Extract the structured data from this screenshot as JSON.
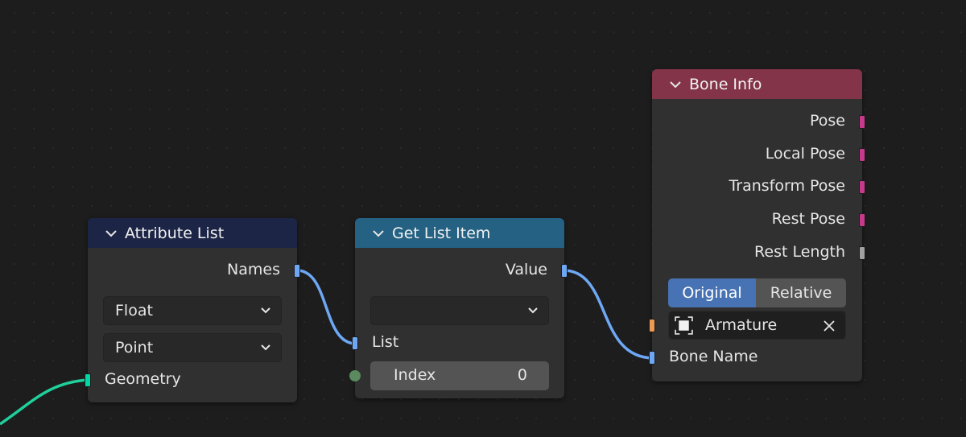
{
  "nodes": {
    "attribute_list": {
      "title": "Attribute List",
      "header_color": "#1d2547",
      "outputs": {
        "names": "Names"
      },
      "data_type": "Float",
      "domain": "Point",
      "inputs": {
        "geometry": "Geometry"
      }
    },
    "get_list_item": {
      "title": "Get List Item",
      "header_color": "#246182",
      "outputs": {
        "value": "Value"
      },
      "type_select": "",
      "inputs": {
        "list": "List",
        "index_label": "Index",
        "index_value": "0"
      }
    },
    "bone_info": {
      "title": "Bone Info",
      "header_color": "#843449",
      "outputs": [
        "Pose",
        "Local Pose",
        "Transform Pose",
        "Rest Pose",
        "Rest Length"
      ],
      "mode_options": [
        "Original",
        "Relative"
      ],
      "mode_selected": "Original",
      "armature": "Armature",
      "inputs": {
        "bone_name": "Bone Name"
      }
    }
  },
  "colors": {
    "socket_string": "#6ea8f5",
    "socket_matrix": "#c7398d",
    "socket_float": "#a1a1a1",
    "socket_object": "#ed9a54",
    "socket_geometry": "#00d6a3",
    "socket_int": "#5a8a5e",
    "link_string": "#6ea8f5",
    "link_geometry": "#1fcf9c",
    "accent": "#4772b3"
  }
}
